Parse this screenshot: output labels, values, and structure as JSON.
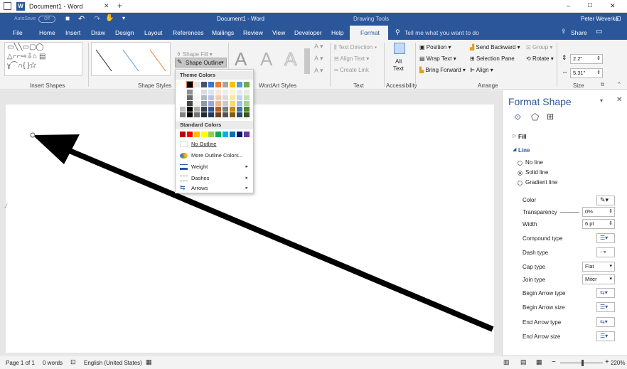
{
  "window": {
    "title": "Document1 - Word",
    "minimize": "–",
    "maximize": "□",
    "close": "✕"
  },
  "qat": {
    "autosave": "AutoSave",
    "autosave_state": "Off",
    "doc_title": "Document1 - Word",
    "context_title": "Drawing Tools",
    "user": "Peter Weverka"
  },
  "tabs": [
    {
      "label": "File"
    },
    {
      "label": "Home"
    },
    {
      "label": "Insert"
    },
    {
      "label": "Draw"
    },
    {
      "label": "Design"
    },
    {
      "label": "Layout"
    },
    {
      "label": "References"
    },
    {
      "label": "Mailings"
    },
    {
      "label": "Review"
    },
    {
      "label": "View"
    },
    {
      "label": "Developer"
    },
    {
      "label": "Help"
    },
    {
      "label": "Format"
    }
  ],
  "tell_me": "Tell me what you want to do",
  "share": "Share",
  "ribbon": {
    "groups": {
      "insert_shapes": "Insert Shapes",
      "shape_styles": "Shape Styles",
      "wordart_styles": "WordArt Styles",
      "text": "Text",
      "accessibility": "Accessibility",
      "arrange": "Arrange",
      "size": "Size"
    },
    "shape_fill": "Shape Fill",
    "shape_outline": "Shape Outline",
    "text_direction": "Text Direction",
    "align_text": "Align Text",
    "create_link": "Create Link",
    "alt_text_line1": "Alt",
    "alt_text_line2": "Text",
    "position": "Position",
    "wrap_text": "Wrap Text",
    "bring_forward": "Bring Forward",
    "send_backward": "Send Backward",
    "selection_pane": "Selection Pane",
    "align": "Align",
    "group": "Group",
    "rotate": "Rotate",
    "height": "2.2\"",
    "width": "5.31\""
  },
  "dropdown": {
    "theme_colors": "Theme Colors",
    "standard_colors": "Standard Colors",
    "no_outline": "No Outline",
    "more_colors": "More Outline Colors...",
    "weight": "Weight",
    "dashes": "Dashes",
    "arrows": "Arrows",
    "theme_top": [
      "#ffffff",
      "#000000",
      "#e7e6e6",
      "#44546a",
      "#4472c4",
      "#ed7d31",
      "#a5a5a5",
      "#ffc000",
      "#5b9bd5",
      "#70ad47"
    ],
    "standard": [
      "#c00000",
      "#ff0000",
      "#ffc000",
      "#ffff00",
      "#92d050",
      "#00b050",
      "#00b0f0",
      "#0070c0",
      "#002060",
      "#7030a0"
    ]
  },
  "pane": {
    "title": "Format Shape",
    "fill": "Fill",
    "line": "Line",
    "no_line": "No line",
    "solid_line": "Solid line",
    "gradient_line": "Gradient line",
    "color": "Color",
    "transparency": "Transparency",
    "transparency_value": "0%",
    "width": "Width",
    "width_value": "6 pt",
    "compound_type": "Compound type",
    "dash_type": "Dash type",
    "cap_type": "Cap type",
    "cap_value": "Flat",
    "join_type": "Join type",
    "join_value": "Miter",
    "begin_arrow_type": "Begin Arrow type",
    "begin_arrow_size": "Begin Arrow size",
    "end_arrow_type": "End Arrow type",
    "end_arrow_size": "End Arrow size"
  },
  "status": {
    "page": "Page 1 of 1",
    "words": "0 words",
    "language": "English (United States)",
    "zoom": "220%"
  }
}
